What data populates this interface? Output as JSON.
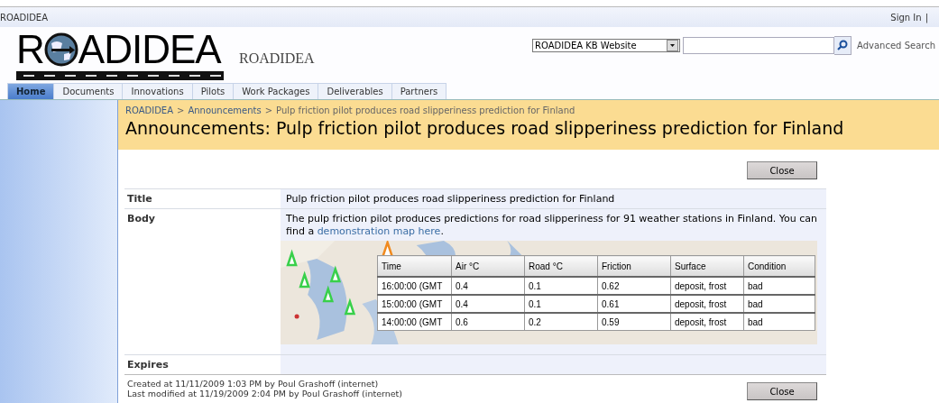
{
  "top_bar": {
    "site": "ROADIDEA",
    "sign_in": "Sign In",
    "separator": "|"
  },
  "header": {
    "logo": {
      "start": "R",
      "end": "ADIDEA"
    },
    "site_title": "ROADIDEA",
    "scope": "ROADIDEA KB Website",
    "advanced_search": "Advanced Search"
  },
  "tabs": [
    {
      "label": "Home",
      "selected": true
    },
    {
      "label": "Documents",
      "selected": false
    },
    {
      "label": "Innovations",
      "selected": false
    },
    {
      "label": "Pilots",
      "selected": false
    },
    {
      "label": "Work Packages",
      "selected": false
    },
    {
      "label": "Deliverables",
      "selected": false
    },
    {
      "label": "Partners",
      "selected": false
    }
  ],
  "breadcrumb": [
    {
      "label": "ROADIDEA",
      "kind": "link"
    },
    {
      "label": ">",
      "kind": "sep"
    },
    {
      "label": "Announcements",
      "kind": "link"
    },
    {
      "label": ">",
      "kind": "sep"
    },
    {
      "label": "Pulp friction pilot produces road slipperiness prediction for Finland",
      "kind": "current"
    }
  ],
  "page_title": "Announcements: Pulp friction pilot produces road slipperiness prediction for Finland",
  "close_button": "Close",
  "fields": [
    {
      "label": "Title",
      "kind": "text",
      "value": "Pulp friction pilot produces road slipperiness prediction for Finland"
    },
    {
      "label": "Body",
      "kind": "body",
      "text": "The pulp friction pilot produces predictions for road slipperiness for 91 weather stations in Finland. You can find a ",
      "link": "demonstration map here",
      "after": ".",
      "map": {
        "kind": "picture",
        "table": {
          "columns": [
            "Time",
            "Air °C",
            "Road °C",
            "Friction",
            "Surface",
            "Condition"
          ],
          "rows": [
            [
              "16:00:00 (GMT",
              "0.4",
              "0.1",
              "0.62",
              "deposit, frost",
              "bad"
            ],
            [
              "15:00:00 (GMT",
              "0.4",
              "0.1",
              "0.61",
              "deposit, frost",
              "bad"
            ],
            [
              "14:00:00 (GMT",
              "0.6",
              "0.2",
              "0.59",
              "deposit, frost",
              "bad"
            ]
          ]
        }
      }
    },
    {
      "label": "Expires",
      "kind": "text"
    }
  ],
  "footer": {
    "created": "Created at 11/11/2009 1:03 PM  by Poul Grashoff (internet)",
    "modified": "Last modified at 11/19/2009 2:04 PM  by Poul Grashoff (internet)",
    "close_button": "Close"
  }
}
